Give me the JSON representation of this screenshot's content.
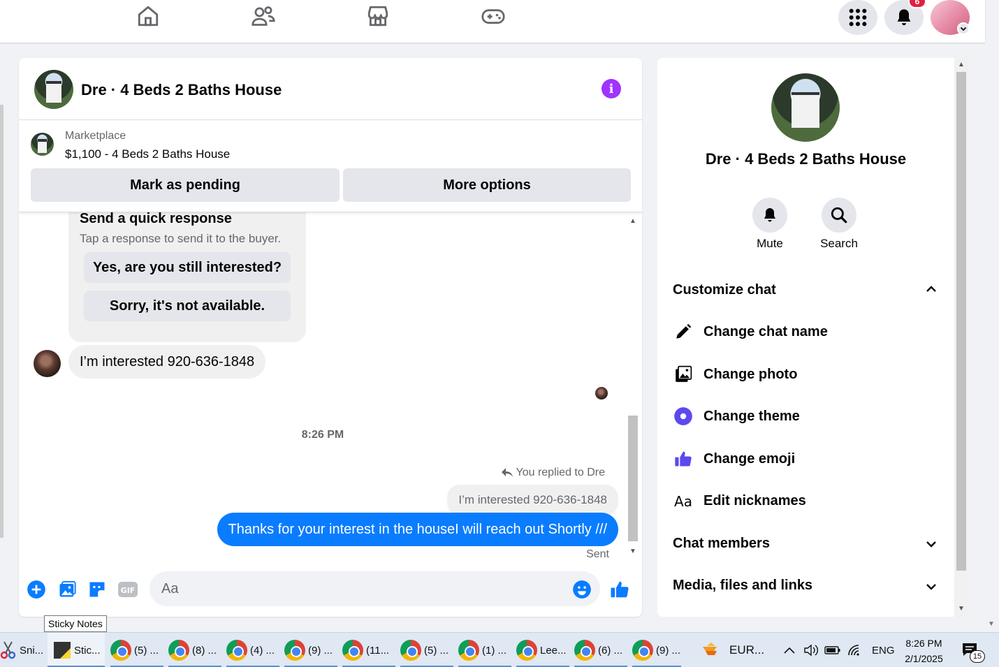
{
  "notifications": {
    "count": "6"
  },
  "chat": {
    "title": "Dre · 4 Beds 2 Baths House",
    "marketplace_label": "Marketplace",
    "listing": "$1,100 - 4 Beds 2 Baths House",
    "mark_pending": "Mark as pending",
    "more_options": "More options",
    "quick_response": {
      "title": "Send a quick response",
      "subtitle": "Tap a response to send it to the buyer.",
      "options": [
        "Yes, are you still interested?",
        "Sorry, it's not available."
      ]
    },
    "incoming_message": "I’m interested 920-636-1848",
    "timestamp": "8:26 PM",
    "replied_to": "You replied to Dre",
    "quoted_message": "I’m interested 920-636-1848",
    "outgoing_message": "Thanks for your interest in the houseI will reach out Shortly ///",
    "status": "Sent",
    "composer_placeholder": "Aa"
  },
  "side_panel": {
    "name": "Dre · 4 Beds 2 Baths House",
    "actions": [
      "Mute",
      "Search"
    ],
    "customize_label": "Customize chat",
    "customize_items": [
      "Change chat name",
      "Change photo",
      "Change theme",
      "Change emoji",
      "Edit nicknames"
    ],
    "chat_members": "Chat members",
    "media": "Media, files and links"
  },
  "tooltip": "Sticky Notes",
  "taskbar": {
    "items": [
      "Sni...",
      "Stic...",
      "(5) ...",
      "(8) ...",
      "(4) ...",
      "(9) ...",
      "(11...",
      "(5) ...",
      "(1) ...",
      "Lee...",
      "(6) ...",
      "(9) ..."
    ],
    "eur": "EUR...",
    "lang": "ENG",
    "time": "8:26 PM",
    "date": "2/1/2025",
    "notif_count": "15"
  },
  "colors": {
    "messenger_blue": "#0a7cff",
    "info_purple": "#a033ff",
    "badge_red": "#e41e3f",
    "theme_indigo": "#5b49f0"
  }
}
